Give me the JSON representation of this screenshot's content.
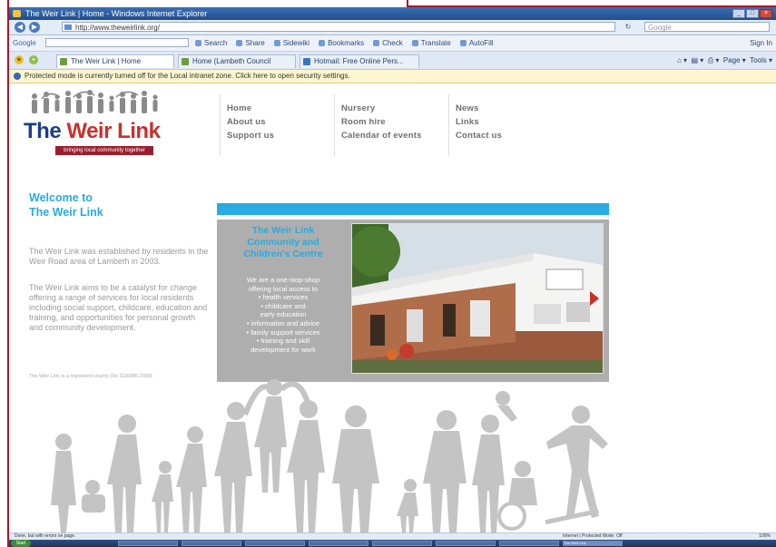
{
  "window": {
    "title": "The Weir Link | Home - Windows Internet Explorer",
    "controls": [
      "_",
      "□",
      "×"
    ]
  },
  "address_bar": {
    "url": "http://www.theweirlink.org/",
    "search_placeholder": "Google"
  },
  "google_toolbar": {
    "label": "Google",
    "items": [
      "Search",
      "Share",
      "Sidewiki",
      "Bookmarks",
      "Check",
      "Translate",
      "AutoFill"
    ],
    "sign_in": "Sign In"
  },
  "tabs": [
    {
      "label": "The Weir Link | Home"
    },
    {
      "label": "Home (Lambeth Council"
    },
    {
      "label": "Hotmail: Free Online Pers..."
    }
  ],
  "command_bar": {
    "page": "Page",
    "tools": "Tools"
  },
  "info_bar": {
    "text": "Protected mode is currently turned off for the Local intranet zone. Click here to open security settings."
  },
  "site": {
    "logo": {
      "text_a": "The ",
      "text_b": "Weir Link",
      "tagline": "bringing local community together"
    },
    "nav": {
      "col1": [
        "Home",
        "About us",
        "Support us"
      ],
      "col2": [
        "Nursery",
        "Room hire",
        "Calendar of events"
      ],
      "col3": [
        "News",
        "Links",
        "Contact us"
      ]
    },
    "welcome": {
      "line1": "Welcome to",
      "line2": "The Weir Link"
    },
    "intro_p1": "The Weir Link was established by residents in the Weir Road area of Lambeth in 2003.",
    "intro_p2": "The Weir Link aims to be a catalyst for change offering a range of services for local residents including social support, childcare, education and training, and opportunities for personal growth and community development.",
    "charity_note": "The Weir Link is a registered charity (No 1116806.2008)",
    "feature": {
      "title": "The Weir Link Community and Children's Centre",
      "lines": [
        "We are a one-stop-shop",
        "offering local access to",
        "• health services",
        "• childcare and",
        "early education",
        "• information and advice",
        "• family support services",
        "• training and skill",
        "development for work"
      ],
      "next_arrow": "›"
    }
  },
  "status_bar": {
    "left": "Done, but with errors on page.",
    "zone": "Internet | Protected Mode: Off",
    "zoom": "100%"
  },
  "taskbar": {
    "start": "Start",
    "items": [
      "",
      "",
      "",
      "",
      "",
      "",
      "",
      "The Weir Link"
    ],
    "clock": ""
  },
  "colors": {
    "accent_blue": "#29aae1",
    "nav_grey": "#6f6f6f",
    "panel_grey": "#aeaeae",
    "logo_red": "#c9302c",
    "logo_navy": "#1c3d8a",
    "frame_red": "#a01c30"
  }
}
